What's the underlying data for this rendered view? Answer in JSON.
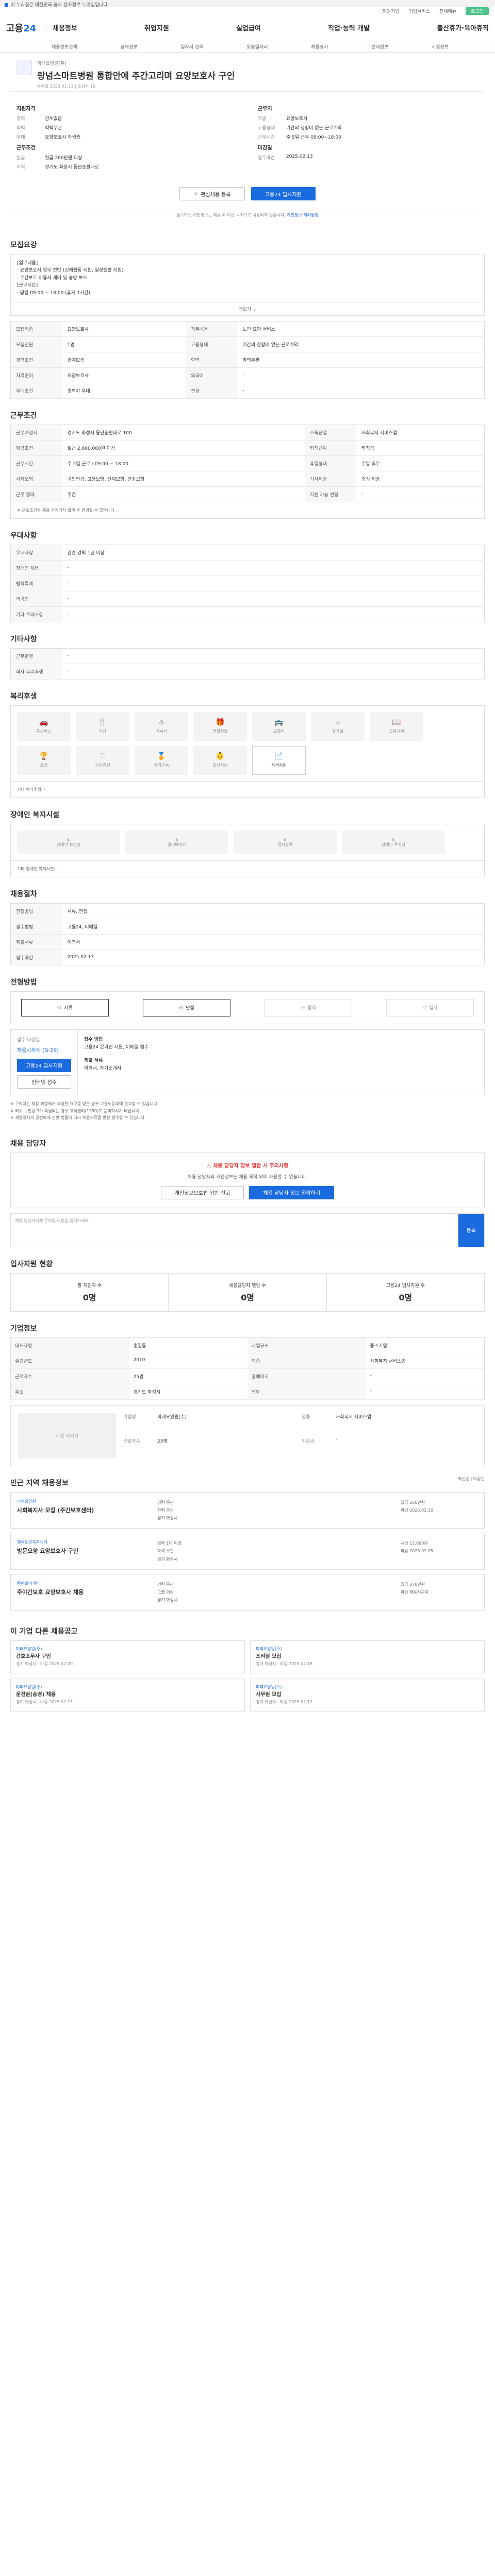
{
  "gov_banner": "이 누리집은 대한민국 공식 전자정부 누리집입니다.",
  "topbar": {
    "links": [
      "회원가입",
      "기업서비스",
      "전체메뉴"
    ],
    "login": "로그인"
  },
  "header": {
    "logo_a": "고용",
    "logo_b": "24",
    "nav": [
      "채용정보",
      "취업지원",
      "실업급여",
      "직업·능력 개발",
      "출산휴가·육아휴직"
    ]
  },
  "subnav": [
    "채용정보검색",
    "공채정보",
    "일자리 검색",
    "맞춤일자리",
    "채용행사",
    "인재정보",
    "기업정보"
  ],
  "job": {
    "company": "미래요양원(주)",
    "title": "랑넘스마트병원 통합안에 주간고리며 요양보호사 구인",
    "meta": "등록일 2025.01.13 | 조회수 10",
    "summary": {
      "left_h": "지원자격",
      "left": [
        [
          "경력",
          "관계없음"
        ],
        [
          "학력",
          "학력무관"
        ],
        [
          "우대",
          "요양보호사 자격증"
        ]
      ],
      "left_h2": "근무조건",
      "left2": [
        [
          "임금",
          "월급 260만원 이상"
        ],
        [
          "지역",
          "경기도 화성시 동탄순환대로"
        ]
      ],
      "right_h": "근무지",
      "right": [
        [
          "직종",
          "요양보호사"
        ],
        [
          "고용형태",
          "기간의 정함이 없는 근로계약"
        ],
        [
          "근무시간",
          "주 5일 근무 09:00~18:00"
        ]
      ],
      "right_h2": "마감일",
      "right2": [
        [
          "접수마감",
          "2025.02.13"
        ]
      ]
    },
    "scrap_label": "관심채용 등록",
    "apply_label": "고용24 입사지원",
    "notice_a": "접수하신 개인정보는 채용 외 다른 목적으로 사용되지 않습니다.",
    "notice_b": "개인정보 처리방침"
  },
  "sections": {
    "job_info": "모집요강",
    "conditions": "근무조건",
    "benefits": "우대사항",
    "other": "기타사항",
    "welfare": "복리후생",
    "disabled": "장애인 복지시설",
    "process": "채용절차",
    "apply": "전형방법",
    "manager": "채용 담당자",
    "stats": "입사지원 현황",
    "company": "기업정보",
    "similar": "인근 지역 채용정보",
    "recommend": "이 기업 다른 채용공고"
  },
  "job_desc": "[업무내용]\n· 요양보호사 업무 전반 (신체활동 지원, 일상생활 지원)\n· 주간보호 이용자 케어 및 송영 보조\n[근무시간]\n· 평일 09:00 ~ 18:00 (휴게 1시간)",
  "more_label": "더보기",
  "job_table": [
    [
      "모집직종",
      "요양보호사",
      "직무내용",
      "노인 요양 서비스"
    ],
    [
      "모집인원",
      "1명",
      "고용형태",
      "기간의 정함이 없는 근로계약"
    ],
    [
      "경력조건",
      "관계없음",
      "학력",
      "학력무관"
    ],
    [
      "자격면허",
      "요양보호사",
      "외국어",
      "-"
    ],
    [
      "우대조건",
      "경력자 우대",
      "전공",
      "-"
    ]
  ],
  "cond_table": [
    [
      "근무예정지",
      "경기도 화성시 동탄순환대로 100",
      "소속산업",
      "사회복지 서비스업"
    ],
    [
      "임금조건",
      "월급 2,600,000원 이상",
      "퇴직급여",
      "퇴직금"
    ],
    [
      "근무시간",
      "주 5일 근무 / 09:00 ~ 18:00",
      "휴일형태",
      "주말 휴무"
    ],
    [
      "사회보험",
      "국민연금, 고용보험, 산재보험, 건강보험",
      "식사제공",
      "중식 제공"
    ],
    [
      "근무 형태",
      "주간",
      "지원 가능 연령",
      "-"
    ]
  ],
  "cond_note": "※ 근로조건은 채용 과정에서 협의 후 변경될 수 있습니다.",
  "benefit_table": [
    [
      "우대사항",
      "관련 경력 1년 이상"
    ],
    [
      "장애인 채용",
      "-"
    ],
    [
      "병역특례",
      "-"
    ],
    [
      "외국인",
      "-"
    ],
    [
      "기타 우대사항",
      "-"
    ]
  ],
  "other_table": [
    [
      "근무환경",
      "-"
    ],
    [
      "회사 복리후생",
      "-"
    ]
  ],
  "welfare_items": [
    [
      "car-icon",
      "통근버스"
    ],
    [
      "meal-icon",
      "식당"
    ],
    [
      "home-icon",
      "기숙사"
    ],
    [
      "gift-icon",
      "명절선물"
    ],
    [
      "bus-icon",
      "교통비"
    ],
    [
      "coffee-icon",
      "휴게실"
    ],
    [
      "book-icon",
      "교육지원"
    ],
    [
      "trophy-icon",
      "포상"
    ],
    [
      "heart-icon",
      "건강검진"
    ],
    [
      "medal-icon",
      "장기근속"
    ],
    [
      "baby-icon",
      "출산지원"
    ],
    [
      "doc-icon",
      "자격지원"
    ]
  ],
  "welfare_note": "기타 복리후생: -",
  "disabled_items": [
    "장애인 화장실",
    "엘리베이터",
    "점자블록",
    "장애인 주차장"
  ],
  "disabled_note": "기타 장애인 복지시설: -",
  "process_table": [
    [
      "전형방법",
      "서류, 면접"
    ],
    [
      "접수방법",
      "고용24, 이메일"
    ],
    [
      "제출서류",
      "이력서"
    ],
    [
      "접수마감",
      "2025.02.13"
    ]
  ],
  "apply_steps": [
    "서류",
    "면접",
    "합격",
    "입사"
  ],
  "apply_left": {
    "label": "접수 마감일",
    "date": "채용시까지 (D-29)",
    "btn1": "고용24 입사지원",
    "btn2": "인터넷 접수"
  },
  "apply_right": {
    "h1": "접수 방법",
    "v1": "고용24 온라인 지원, 이메일 접수",
    "h2": "제출 서류",
    "v2": "이력서, 자기소개서"
  },
  "apply_bullets": [
    "※ 구직자는 채용 과정에서 부당한 요구를 받은 경우 고용노동부에 신고할 수 있습니다.",
    "※ 허위 구인광고가 의심되는 경우 고객센터(1350)로 문의하시기 바랍니다.",
    "※ 채용절차의 공정화에 관한 법률에 따라 채용서류를 반환 청구할 수 있습니다."
  ],
  "manager": {
    "warn": "채용 담당자 정보 열람 시 주의사항",
    "desc": "채용 담당자의 개인정보는 채용 목적 외에 사용할 수 없습니다.",
    "btn1": "개인정보보호법 위반 신고",
    "btn2": "채용 담당자 정보 열람하기",
    "qa_placeholder": "채용 담당자에게 문의할 내용을 입력하세요.",
    "qa_btn": "등록"
  },
  "stats": [
    [
      "총 지원자 수",
      "0명"
    ],
    [
      "채용담당자 열람 수",
      "0명"
    ],
    [
      "고용24 입사지원 수",
      "0명"
    ]
  ],
  "company_grid": [
    [
      "대표자명",
      "홍길동",
      "기업규모",
      "중소기업"
    ],
    [
      "설립년도",
      "2010",
      "업종",
      "사회복지 서비스업"
    ],
    [
      "근로자수",
      "25명",
      "홈페이지",
      "-"
    ],
    [
      "주소",
      "경기도 화성시",
      "전화",
      "-"
    ]
  ],
  "company_info": {
    "img": "기업 이미지",
    "rows": [
      [
        "기업명",
        "미래요양원(주)"
      ],
      [
        "업종",
        "사회복지 서비스업"
      ],
      [
        "근로자수",
        "25명"
      ],
      [
        "자본금",
        "-"
      ]
    ]
  },
  "similar_sort": "최신순 | 마감순",
  "similar_list": [
    {
      "tag": "미래요양원",
      "title": "사회복지사 모집 (주간보호센터)",
      "mid": [
        "경력 무관",
        "학력 무관",
        "경기 화성시"
      ],
      "right": [
        "월급 250만원",
        "마감 2025.02.10"
      ]
    },
    {
      "tag": "행복노인복지센터",
      "title": "방문요양 요양보호사 구인",
      "mid": [
        "경력 1년 이상",
        "학력 무관",
        "경기 화성시"
      ],
      "right": [
        "시급 12,000원",
        "마감 2025.02.05"
      ]
    },
    {
      "tag": "동탄실버케어",
      "title": "주야간보호 요양보호사 채용",
      "mid": [
        "경력 무관",
        "고졸 이상",
        "경기 화성시"
      ],
      "right": [
        "월급 270만원",
        "마감 채용시까지"
      ]
    }
  ],
  "recommend_list": [
    {
      "c": "미래요양원(주)",
      "t": "간호조무사 구인",
      "d": "경기 화성시 · 마감 2025.02.20"
    },
    {
      "c": "미래요양원(주)",
      "t": "조리원 모집",
      "d": "경기 화성시 · 마감 2025.02.18"
    },
    {
      "c": "미래요양원(주)",
      "t": "운전원(송영) 채용",
      "d": "경기 화성시 · 마감 2025.02.15"
    },
    {
      "c": "미래요양원(주)",
      "t": "사무원 모집",
      "d": "경기 화성시 · 마감 2025.02.12"
    }
  ]
}
